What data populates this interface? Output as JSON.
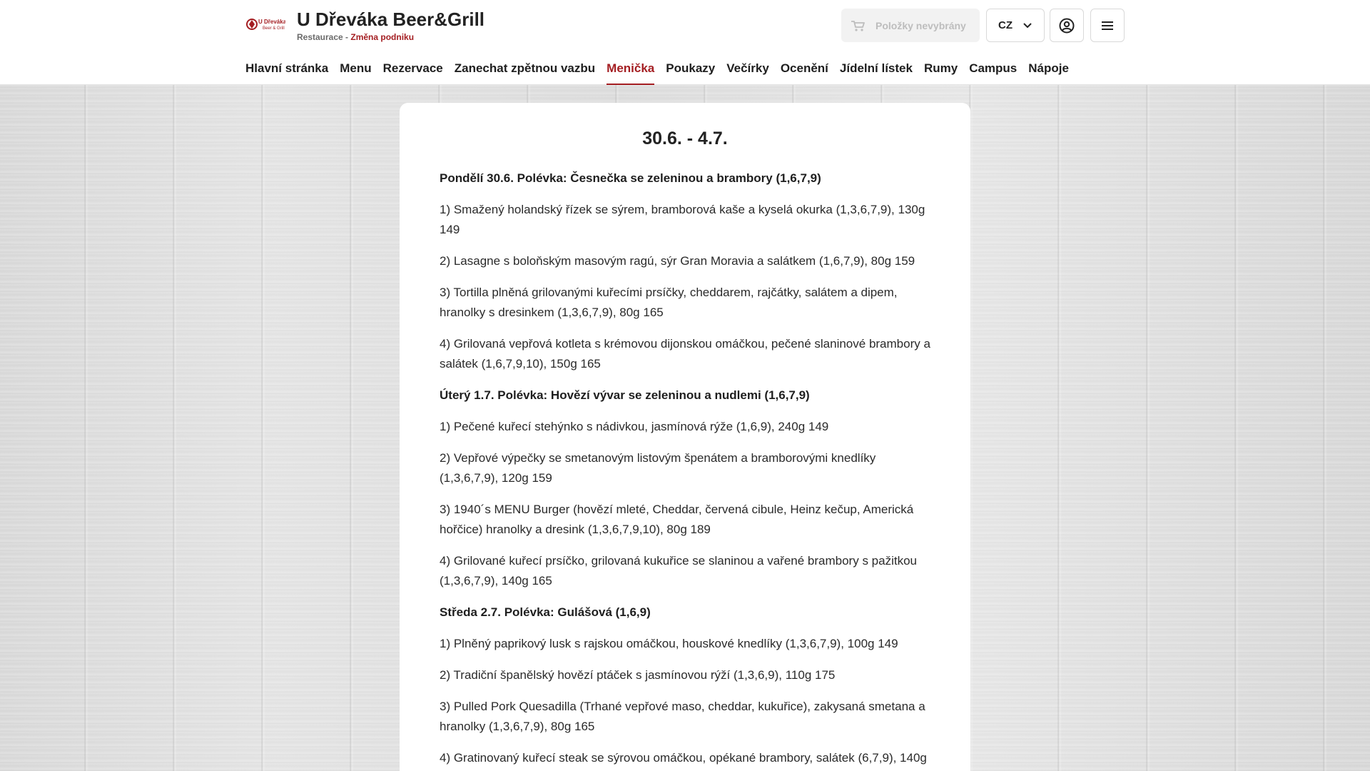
{
  "header": {
    "name": "U Dřeváka Beer&Grill",
    "logo_text": "U Dřeváka Beer & Grill",
    "subtitle_prefix": "Restaurace - ",
    "subtitle_link": "Změna podniku",
    "cart_label": "Položky nevybrány",
    "language": "CZ",
    "brand_color": "#a41e22"
  },
  "nav": [
    {
      "label": "Hlavní stránka"
    },
    {
      "label": "Menu"
    },
    {
      "label": "Rezervace"
    },
    {
      "label": "Zanechat zpětnou vazbu"
    },
    {
      "label": "Menička",
      "active": true
    },
    {
      "label": "Poukazy"
    },
    {
      "label": "Večírky"
    },
    {
      "label": "Ocenění"
    },
    {
      "label": "Jídelní lístek"
    },
    {
      "label": "Rumy"
    },
    {
      "label": "Campus"
    },
    {
      "label": "Nápoje"
    }
  ],
  "content": {
    "week": "30.6. - 4.7.",
    "lines": [
      {
        "type": "day",
        "text": "Pondělí 30.6. Polévka: Česnečka se zeleninou a brambory (1,6,7,9)"
      },
      {
        "type": "dish",
        "text": "1) Smažený holandský řízek se sýrem, bramborová kaše a kyselá okurka (1,3,6,7,9), 130g 149"
      },
      {
        "type": "dish",
        "text": "2) Lasagne s boloňským masovým ragú, sýr Gran Moravia a salátkem (1,6,7,9), 80g 159"
      },
      {
        "type": "dish",
        "text": "3) Tortilla plněná grilovanými kuřecími prsíčky, cheddarem, rajčátky, salátem a dipem, hranolky s dresinkem (1,3,6,7,9), 80g 165"
      },
      {
        "type": "dish",
        "text": "4) Grilovaná vepřová kotleta s krémovou dijonskou omáčkou, pečené slaninové brambory a salátek (1,6,7,9,10), 150g 165"
      },
      {
        "type": "day",
        "text": "Úterý 1.7. Polévka: Hovězí vývar se zeleninou a nudlemi (1,6,7,9)"
      },
      {
        "type": "dish",
        "text": "1) Pečené kuřecí stehýnko s nádivkou, jasmínová rýže (1,6,9), 240g 149"
      },
      {
        "type": "dish",
        "text": "2) Vepřové výpečky se smetanovým listovým špenátem a bramborovými knedlíky (1,3,6,7,9), 120g 159"
      },
      {
        "type": "dish",
        "text": "3) 1940´s MENU Burger (hovězí mleté, Cheddar, červená cibule, Heinz kečup, Americká hořčice) hranolky a dresink (1,3,6,7,9,10), 80g 189"
      },
      {
        "type": "dish",
        "text": "4) Grilované kuřecí prsíčko, grilovaná kukuřice se slaninou a vařené brambory s pažitkou (1,3,6,7,9), 140g 165"
      },
      {
        "type": "day",
        "text": "Středa 2.7. Polévka: Gulášová (1,6,9)"
      },
      {
        "type": "dish",
        "text": "1) Plněný paprikový lusk s rajskou omáčkou, houskové knedlíky (1,3,6,7,9), 100g 149"
      },
      {
        "type": "dish",
        "text": "2) Tradiční španělský hovězí ptáček s jasmínovou rýží (1,3,6,9), 110g 175"
      },
      {
        "type": "dish",
        "text": "3) Pulled Pork Quesadilla (Trhané vepřové maso, cheddar, kukuřice), zakysaná smetana a hranolky (1,3,6,7,9), 80g 165"
      },
      {
        "type": "dish",
        "text": "4) Gratinovaný kuřecí steak se sýrovou omáčkou, opékané brambory, salátek (6,7,9), 140g"
      }
    ]
  }
}
